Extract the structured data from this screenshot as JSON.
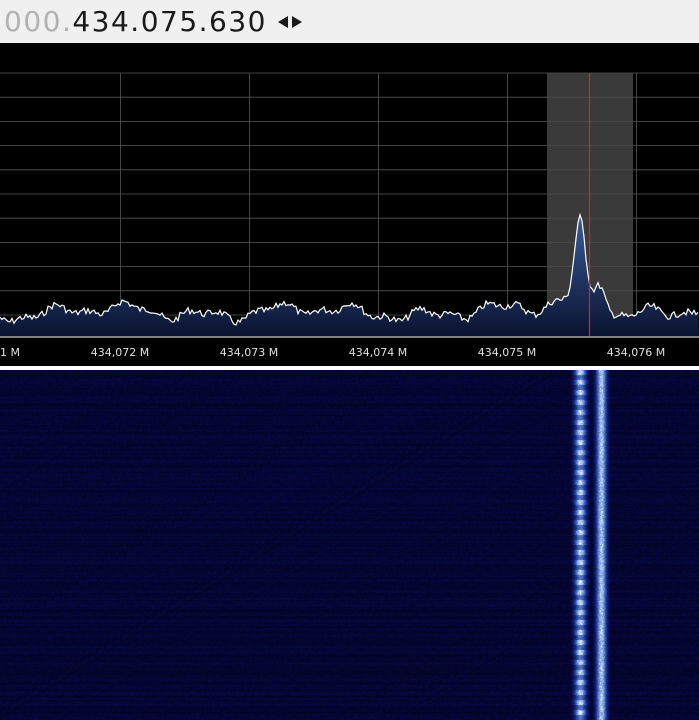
{
  "frequency": {
    "prefix": "000.",
    "value": "434.075.630"
  },
  "spectrum": {
    "freq_labels": [
      "1 M",
      "434,072 M",
      "434,073 M",
      "434,074 M",
      "434,075 M",
      "434,076 M"
    ],
    "colors": {
      "background": "#000000",
      "grid": "#555555",
      "trace": "#ffffff",
      "fill_top": "#3b5c9a",
      "fill_bottom": "#0a1330",
      "filter_band": "#4a4a4a",
      "center_line": "#e02020"
    }
  },
  "waterfall": {
    "colors": {
      "noise_floor": "#08083a",
      "signal": "#ffffff",
      "signal_mid": "#3d7be0"
    }
  },
  "icons": {
    "tune_arrows": "left-right-arrows-icon"
  }
}
